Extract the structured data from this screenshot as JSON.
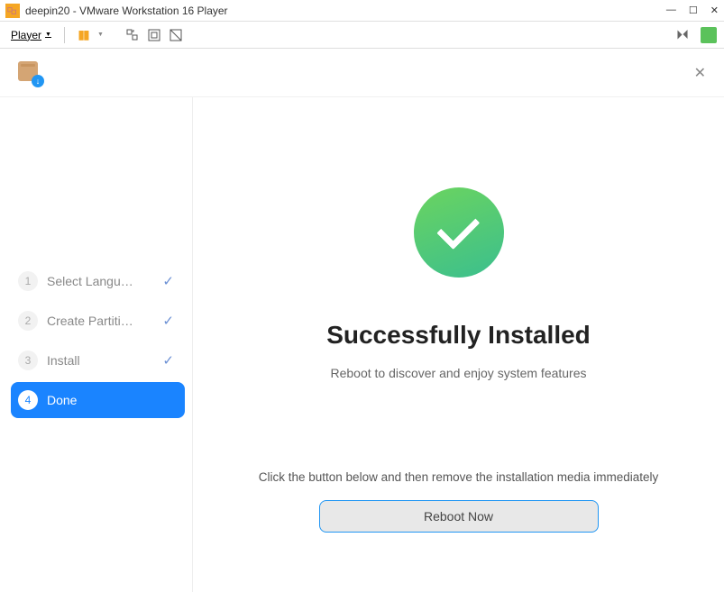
{
  "window": {
    "title": "deepin20 - VMware Workstation 16 Player"
  },
  "toolbar": {
    "player_menu": "Player"
  },
  "sidebar": {
    "steps": [
      {
        "num": "1",
        "label": "Select Langu…",
        "done": true,
        "active": false
      },
      {
        "num": "2",
        "label": "Create Partiti…",
        "done": true,
        "active": false
      },
      {
        "num": "3",
        "label": "Install",
        "done": true,
        "active": false
      },
      {
        "num": "4",
        "label": "Done",
        "done": false,
        "active": true
      }
    ]
  },
  "main": {
    "heading": "Successfully Installed",
    "subtitle": "Reboot to discover and enjoy system features",
    "hint": "Click the button below and then remove the installation media immediately",
    "reboot_label": "Reboot Now"
  }
}
